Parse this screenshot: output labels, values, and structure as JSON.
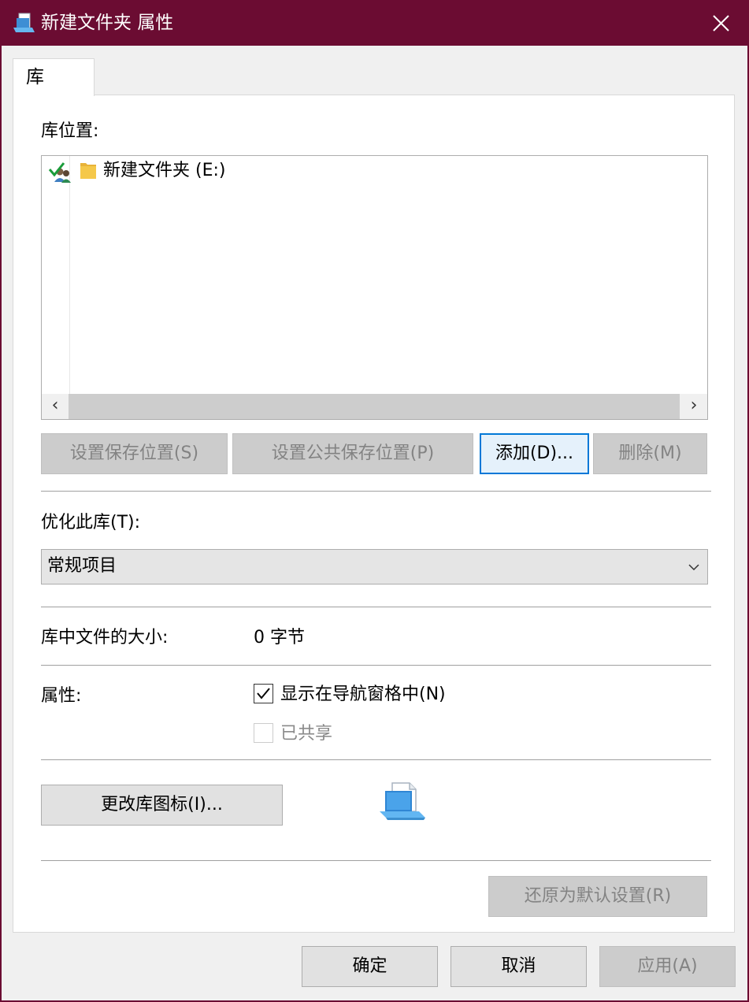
{
  "window": {
    "title": "新建文件夹 属性",
    "title_icon": "library-icon",
    "close_icon": "close-icon"
  },
  "tabs": [
    {
      "label": "库",
      "selected": true
    }
  ],
  "library_locations": {
    "label": "库位置:",
    "items": [
      {
        "text": "新建文件夹 (E:)",
        "status_icon": "default-save-location-check-icon",
        "icon": "folder-icon"
      }
    ],
    "scroll_left_icon": "chevron-left-icon",
    "scroll_right_icon": "chevron-right-icon"
  },
  "location_buttons": {
    "set_save": "设置保存位置(S)",
    "set_public_save": "设置公共保存位置(P)",
    "add": "添加(D)...",
    "remove": "删除(M)"
  },
  "optimize": {
    "label": "优化此库(T):",
    "selected": "常规项目",
    "dropdown_icon": "chevron-down-icon"
  },
  "size": {
    "label": "库中文件的大小:",
    "value": "0 字节"
  },
  "attributes": {
    "label": "属性:",
    "show_in_nav": {
      "label": "显示在导航窗格中(N)",
      "checked": true,
      "enabled": true
    },
    "shared": {
      "label": "已共享",
      "checked": false,
      "enabled": false
    }
  },
  "icon_section": {
    "change_icon_button": "更改库图标(I)...",
    "preview_icon": "library-preview-icon"
  },
  "restore_defaults": "还原为默认设置(R)",
  "dialog_buttons": {
    "ok": "确定",
    "cancel": "取消",
    "apply": "应用(A)"
  },
  "colors": {
    "title_bar": "#6b0c32",
    "focus_border": "#0078d7",
    "folder": "#f5c84a"
  }
}
